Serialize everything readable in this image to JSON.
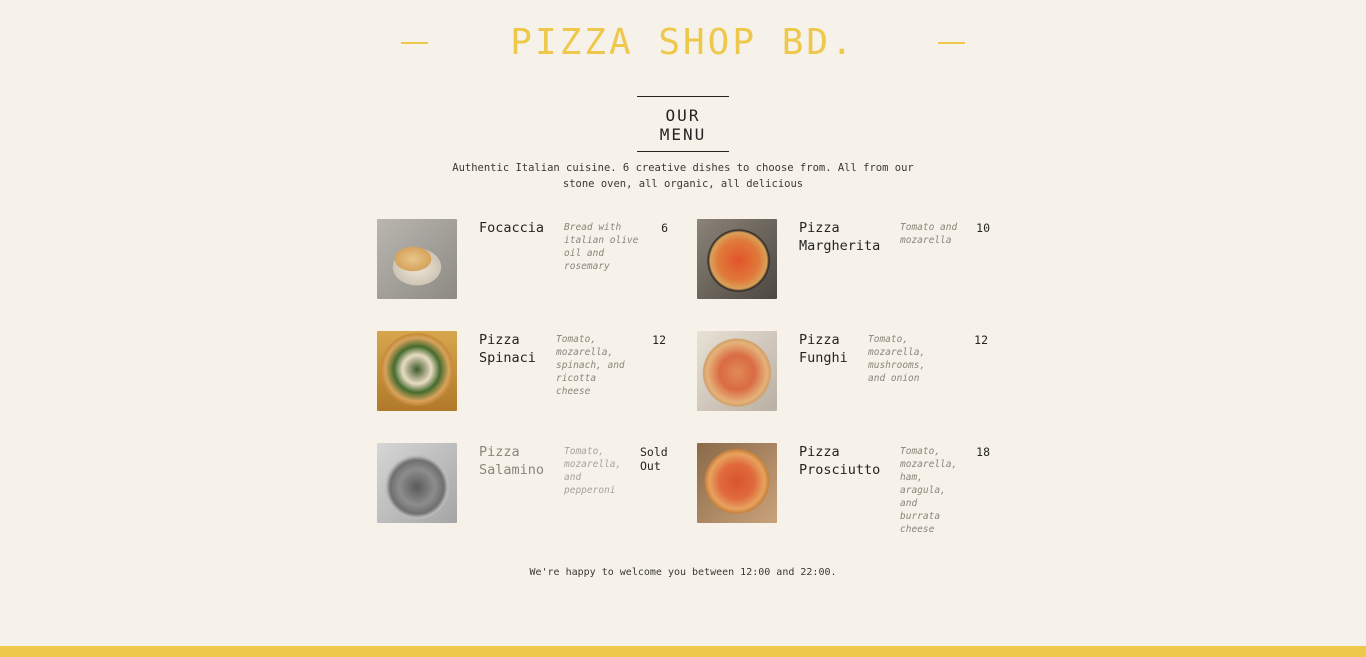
{
  "header": {
    "brand": "PIZZA SHOP BD."
  },
  "menu": {
    "title": "OUR MENU",
    "intro": "Authentic Italian cuisine. 6 creative dishes to choose from. All from our stone oven, all organic, all delicious",
    "items": [
      {
        "name": "Focaccia",
        "description": "Bread with italian olive oil and rosemary",
        "price": "6",
        "photo": "focaccia-photo"
      },
      {
        "name": "Pizza Margherita",
        "description": "Tomato and mozarella",
        "price": "10",
        "photo": "margherita-photo"
      },
      {
        "name": "Pizza Spinaci",
        "description": "Tomato, mozarella, spinach, and ricotta cheese",
        "price": "12",
        "photo": "spinaci-photo"
      },
      {
        "name": "Pizza Funghi",
        "description": "Tomato, mozarella, mushrooms, and onion",
        "price": "12",
        "photo": "funghi-photo"
      },
      {
        "name": "Pizza Salamino",
        "description": "Tomato, mozarella, and pepperoni",
        "price": "Sold Out",
        "photo": "salamino-photo",
        "sold_out": true
      },
      {
        "name": "Pizza Prosciutto",
        "description": "Tomato, mozarella, ham, aragula, and burrata cheese",
        "price": "18",
        "photo": "prosciutto-photo"
      }
    ]
  },
  "footer": {
    "text": "We're happy to welcome you between 12:00 and 22:00."
  },
  "colors": {
    "background": "#f7f2e9",
    "accent": "#edc84b",
    "text": "#252422"
  }
}
